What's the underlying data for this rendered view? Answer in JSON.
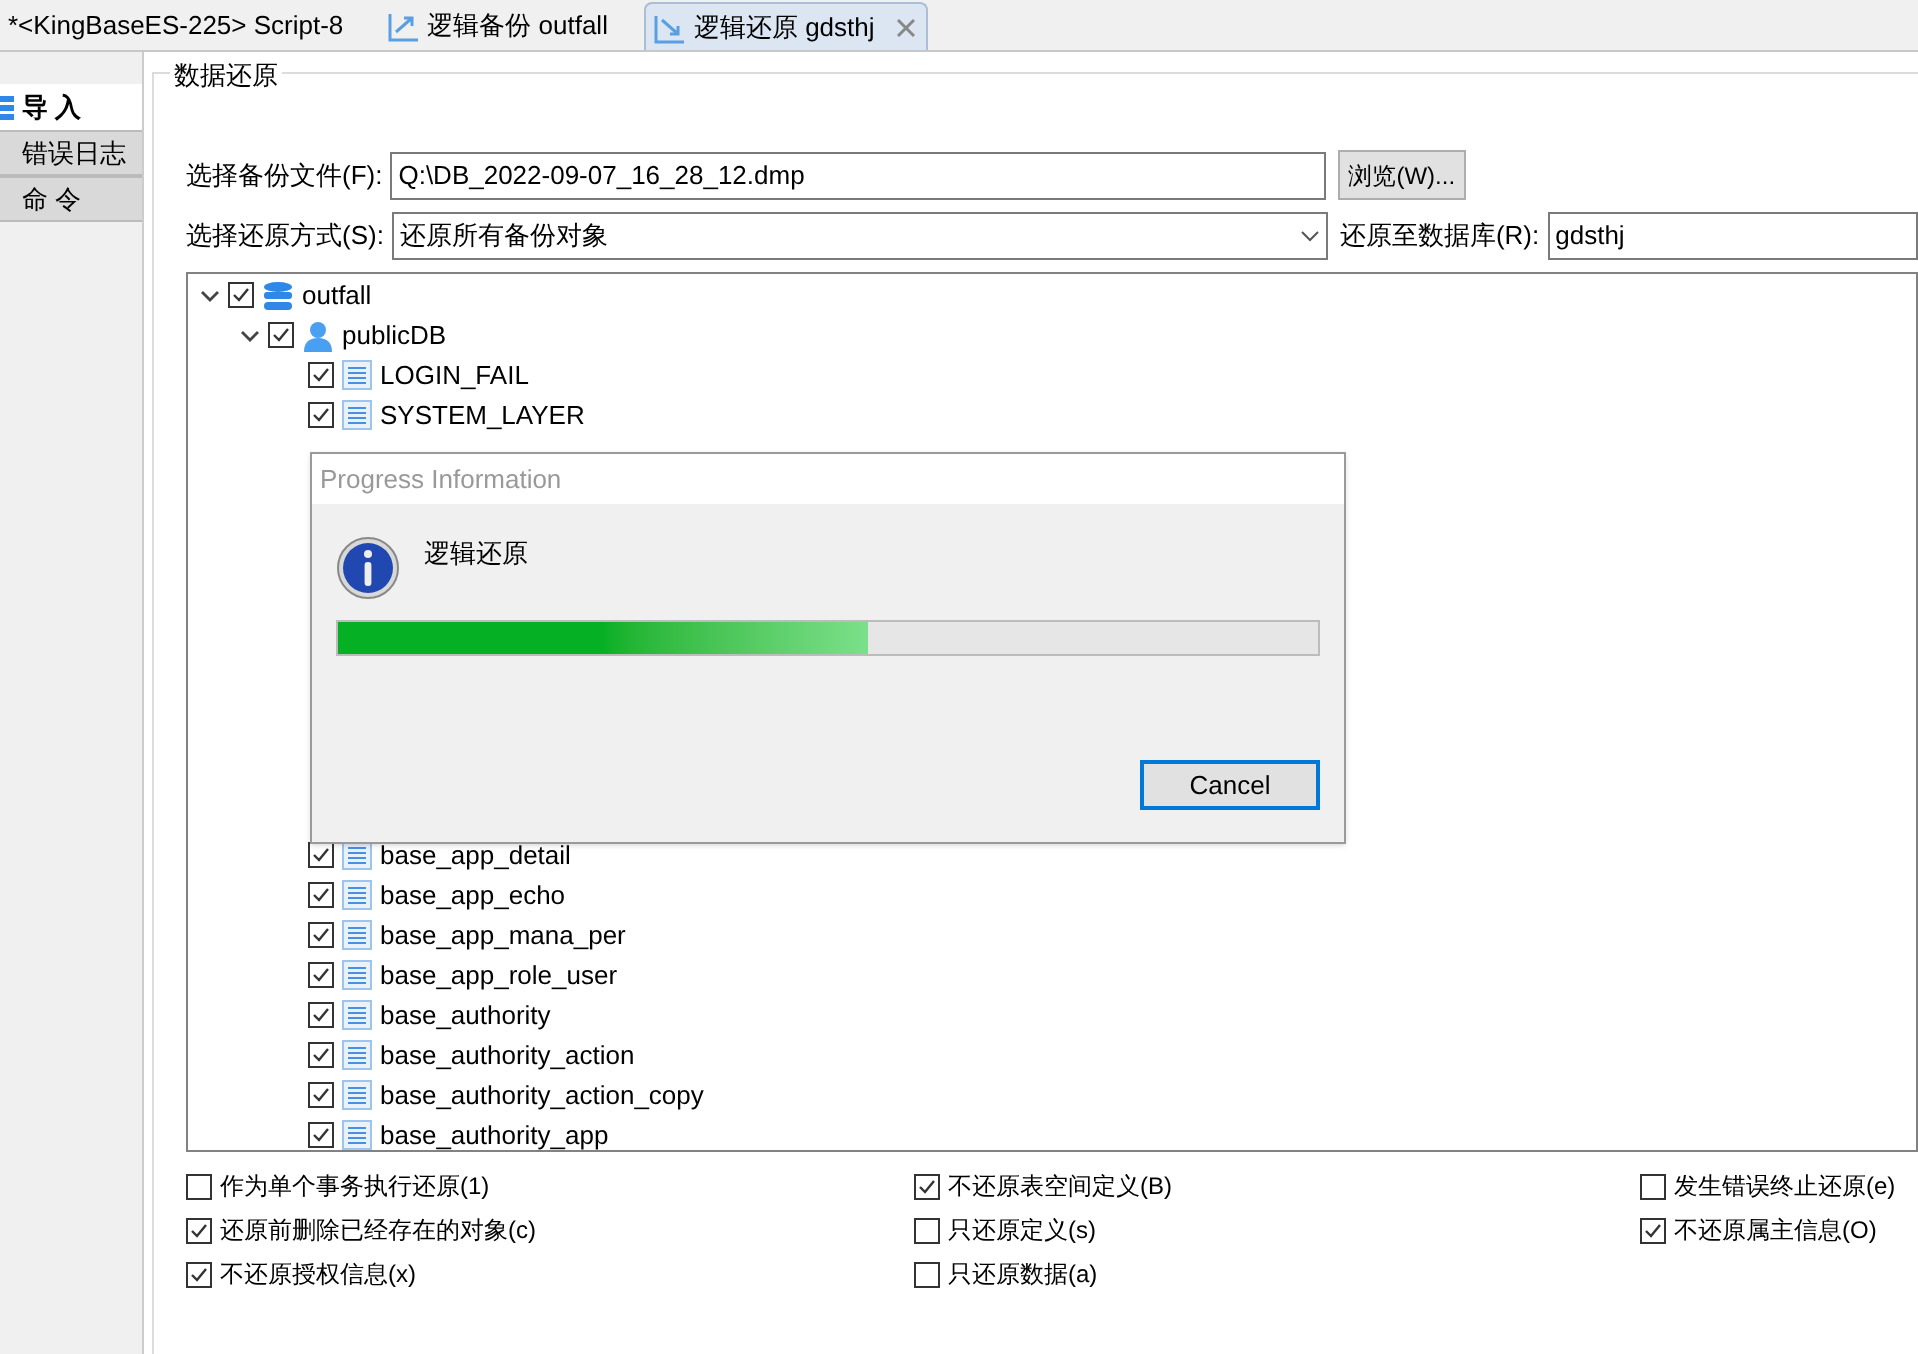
{
  "tabs": [
    {
      "label": "*<KingBaseES-225> Script-8",
      "kind": "plain",
      "selected": false
    },
    {
      "label": "逻辑备份 outfall",
      "kind": "backup",
      "selected": false
    },
    {
      "label": "逻辑还原 gdsthj",
      "kind": "restore",
      "selected": true
    }
  ],
  "sidebar": {
    "items": [
      {
        "label": "导 入",
        "selected": true
      },
      {
        "label": "错误日志",
        "selected": false
      },
      {
        "label": "命 令",
        "selected": false
      }
    ]
  },
  "group_title": "数据还原",
  "backup_file": {
    "label": "选择备份文件(F):",
    "value": "Q:\\DB_2022-09-07_16_28_12.dmp",
    "button": "浏览(W)..."
  },
  "restore_mode": {
    "label": "选择还原方式(S):",
    "value": "还原所有备份对象"
  },
  "target_db": {
    "label": "还原至数据库(R):",
    "value": "gdsthj"
  },
  "tree": [
    {
      "label": "outfall",
      "kind": "database",
      "checked": true,
      "expanded": true,
      "children": [
        {
          "label": "publicDB",
          "kind": "schema",
          "checked": true,
          "expanded": true,
          "children": [
            {
              "label": "LOGIN_FAIL",
              "kind": "table",
              "checked": true
            },
            {
              "label": "SYSTEM_LAYER",
              "kind": "table",
              "checked": true
            },
            {
              "label": "base_app_detail",
              "kind": "table",
              "checked": true
            },
            {
              "label": "base_app_echo",
              "kind": "table",
              "checked": true
            },
            {
              "label": "base_app_mana_per",
              "kind": "table",
              "checked": true
            },
            {
              "label": "base_app_role_user",
              "kind": "table",
              "checked": true
            },
            {
              "label": "base_authority",
              "kind": "table",
              "checked": true
            },
            {
              "label": "base_authority_action",
              "kind": "table",
              "checked": true
            },
            {
              "label": "base_authority_action_copy",
              "kind": "table",
              "checked": true
            },
            {
              "label": "base_authority_app",
              "kind": "table",
              "checked": true
            }
          ]
        }
      ]
    }
  ],
  "options": [
    [
      {
        "label": "作为单个事务执行还原(1)",
        "checked": false
      },
      {
        "label": "还原前删除已经存在的对象(c)",
        "checked": true
      },
      {
        "label": "不还原授权信息(x)",
        "checked": true
      }
    ],
    [
      {
        "label": "不还原表空间定义(B)",
        "checked": true
      },
      {
        "label": "只还原定义(s)",
        "checked": false
      },
      {
        "label": "只还原数据(a)",
        "checked": false
      }
    ],
    [
      {
        "label": "发生错误终止还原(e)",
        "checked": false
      },
      {
        "label": "不还原属主信息(O)",
        "checked": true
      }
    ]
  ],
  "progress_dialog": {
    "title": "Progress Information",
    "message": "逻辑还原",
    "level": 0.54,
    "button": "Cancel"
  }
}
